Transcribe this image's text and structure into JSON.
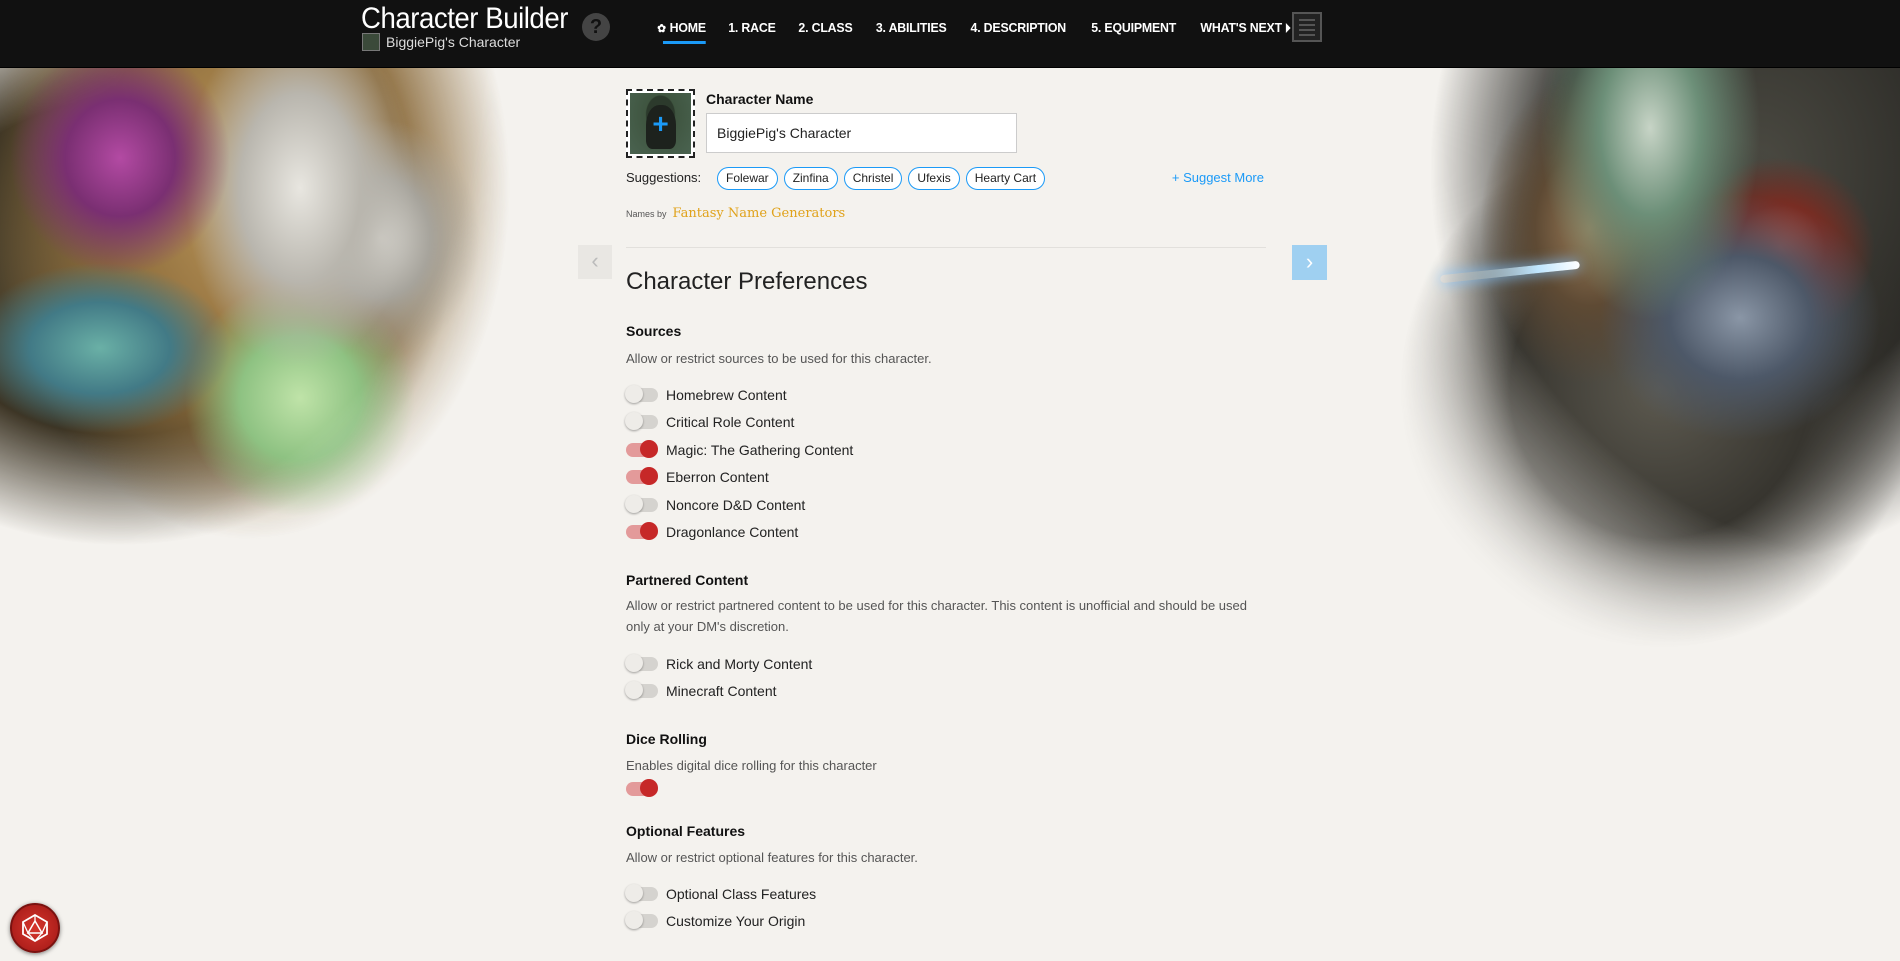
{
  "header": {
    "app_title": "Character Builder",
    "character_name": "BiggiePig's Character",
    "help": "?",
    "nav": [
      {
        "label": "HOME",
        "active": true,
        "icon": "gear-icon"
      },
      {
        "label": "1. RACE",
        "active": false
      },
      {
        "label": "2. CLASS",
        "active": false
      },
      {
        "label": "3. ABILITIES",
        "active": false
      },
      {
        "label": "4. DESCRIPTION",
        "active": false
      },
      {
        "label": "5. EQUIPMENT",
        "active": false
      },
      {
        "label": "WHAT'S NEXT",
        "active": false,
        "icon": "caret-right-icon"
      }
    ],
    "sheet_icon": "character-sheet-icon"
  },
  "name_section": {
    "label": "Character Name",
    "value": "BiggiePig's Character",
    "portrait_plus": "+",
    "suggestions_label": "Suggestions:",
    "suggestions": [
      "Folewar",
      "Zinfina",
      "Christel",
      "Ufexis",
      "Hearty Cart"
    ],
    "suggest_more": "+ Suggest More",
    "names_by": "Names by",
    "names_by_source": "Fantasy Name Generators"
  },
  "navigation": {
    "prev": "‹",
    "next": "›"
  },
  "preferences": {
    "title": "Character Preferences",
    "sources": {
      "title": "Sources",
      "description": "Allow or restrict sources to be used for this character.",
      "items": [
        {
          "label": "Homebrew Content",
          "on": false
        },
        {
          "label": "Critical Role Content",
          "on": false
        },
        {
          "label": "Magic: The Gathering Content",
          "on": true
        },
        {
          "label": "Eberron Content",
          "on": true
        },
        {
          "label": "Noncore D&D Content",
          "on": false
        },
        {
          "label": "Dragonlance Content",
          "on": true
        }
      ]
    },
    "partnered": {
      "title": "Partnered Content",
      "description": "Allow or restrict partnered content to be used for this character. This content is unofficial and should be used only at your DM's discretion.",
      "items": [
        {
          "label": "Rick and Morty Content",
          "on": false
        },
        {
          "label": "Minecraft Content",
          "on": false
        }
      ]
    },
    "dice": {
      "title": "Dice Rolling",
      "description": "Enables digital dice rolling for this character",
      "on": true
    },
    "optional": {
      "title": "Optional Features",
      "description": "Allow or restrict optional features for this character.",
      "items": [
        {
          "label": "Optional Class Features",
          "on": false
        },
        {
          "label": "Customize Your Origin",
          "on": false
        }
      ]
    }
  },
  "colors": {
    "accent": "#1b9af7",
    "toggle_on": "#c62828",
    "header_bg": "#111111"
  },
  "dice_button_icon": "d20-icon"
}
